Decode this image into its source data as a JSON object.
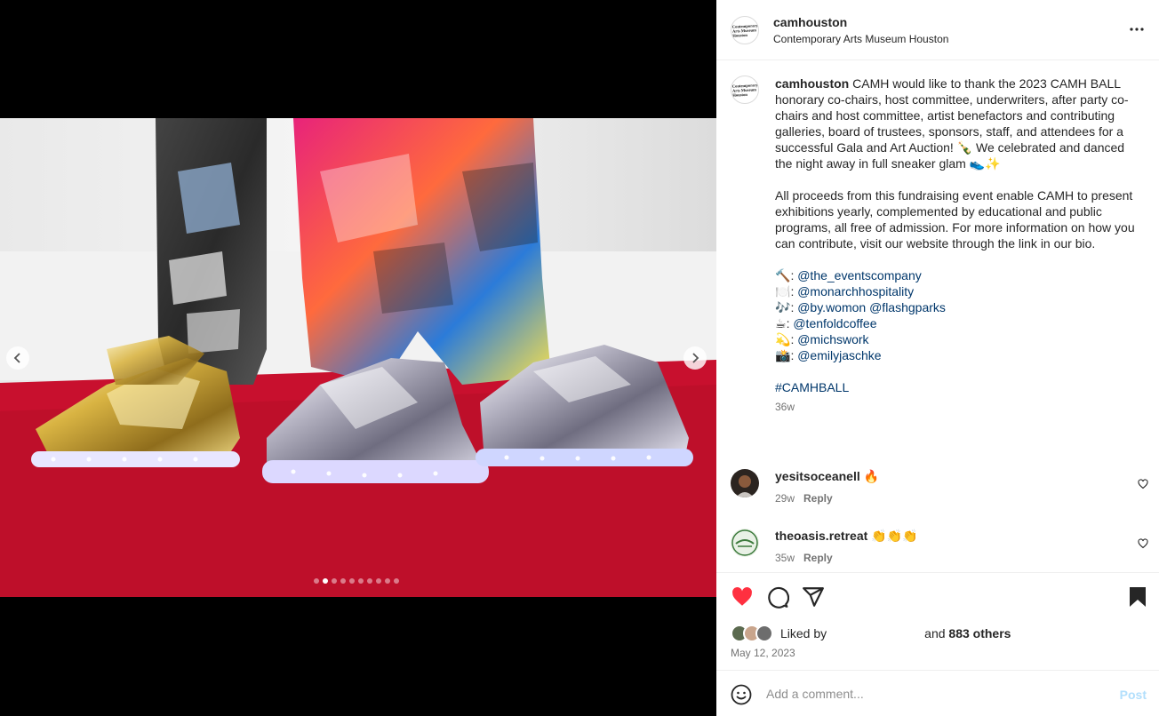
{
  "post": {
    "username": "camhouston",
    "location": "Contemporary Arts Museum Houston",
    "logo_text": "Contemporary Arts Museum Houston",
    "caption": {
      "username": "camhouston",
      "paragraph1": "CAMH would like to thank the 2023 CAMH BALL honorary co-chairs, host committee, underwriters, after party co-chairs and host committee, artist benefactors and contributing galleries, board of trustees, sponsors, staff, and attendees for a successful Gala and Art Auction! 🍾 We celebrated and danced the night away in full sneaker glam 👟✨",
      "paragraph2": "All proceeds from this fundraising event enable CAMH to present exhibitions yearly, complemented by educational and public programs, all free of admission. For more information on how you can contribute, visit our website through the link in our bio.",
      "credits": [
        {
          "emoji": "🔨",
          "handles": "@the_eventscompany"
        },
        {
          "emoji": "🍽️",
          "handles": "@monarchhospitality"
        },
        {
          "emoji": "🎶",
          "handles": "@by.womon @flashgparks"
        },
        {
          "emoji": "☕",
          "handles": "@tenfoldcoffee"
        },
        {
          "emoji": "💫",
          "handles": "@michswork"
        },
        {
          "emoji": "📸",
          "handles": "@emilyjaschke"
        }
      ],
      "hashtag": "#CAMHBALL",
      "time": "36w"
    },
    "comments": [
      {
        "username": "yesitsoceanell",
        "text": "🔥",
        "time": "29w",
        "reply": "Reply"
      },
      {
        "username": "theoasis.retreat",
        "text": "👏👏👏",
        "time": "35w",
        "reply": "Reply"
      }
    ],
    "likes": {
      "prefix": "Liked by",
      "suffix": "and",
      "count": "883 others"
    },
    "date": "May 12, 2023",
    "add_comment": {
      "placeholder": "Add a comment...",
      "post_label": "Post"
    },
    "carousel": {
      "total": 10,
      "active_index": 1
    },
    "colors": {
      "like_red": "#ff3040",
      "link_blue": "#00376b",
      "post_disabled": "#b2dffc",
      "carpet_red": "#c8102e"
    },
    "icons": [
      "more-icon",
      "heart-icon",
      "comment-icon",
      "share-icon",
      "bookmark-icon",
      "emoji-icon",
      "chevron-left-icon",
      "chevron-right-icon"
    ]
  }
}
